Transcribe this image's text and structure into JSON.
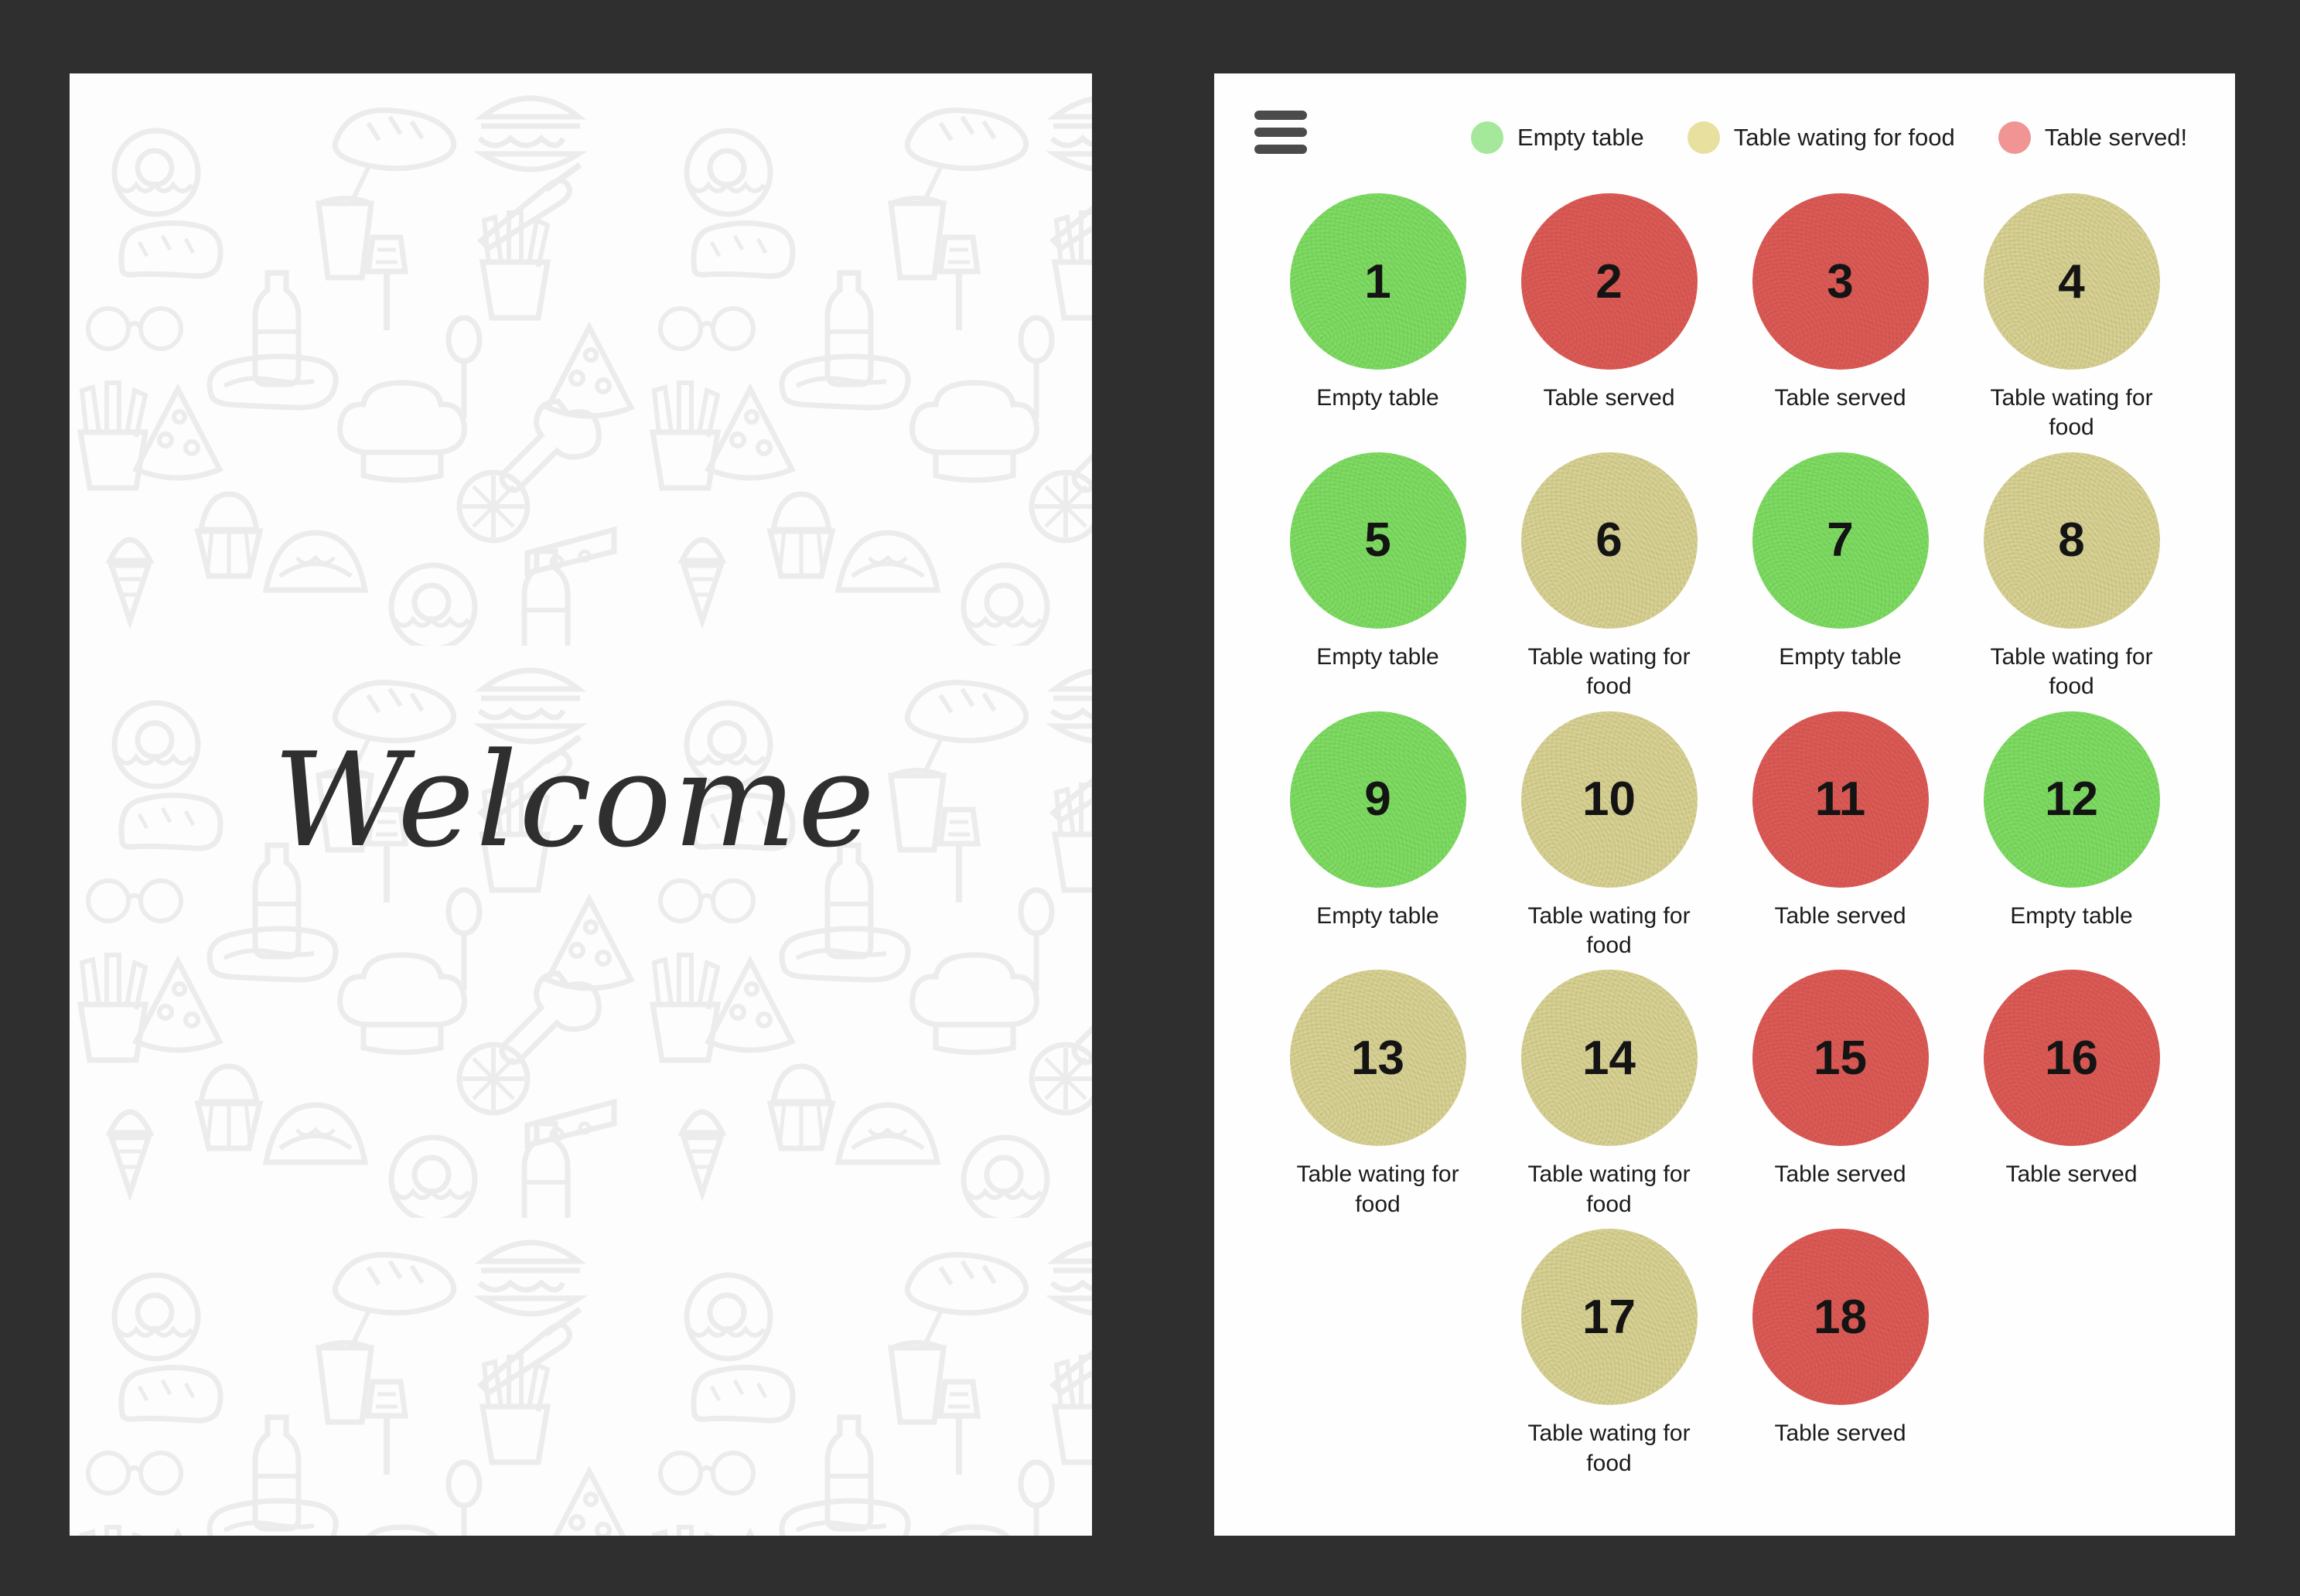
{
  "background_color": "#302f2f",
  "welcome_panel": {
    "title": "Welcome",
    "background_pattern": "food-doodle-pattern"
  },
  "tables_panel": {
    "menu_icon": "hamburger-menu-icon",
    "legend": [
      {
        "label": "Empty table",
        "color": "#A5E89B",
        "status_key": "empty"
      },
      {
        "label": "Table wating for food",
        "color": "#E8E09E",
        "status_key": "waiting"
      },
      {
        "label": "Table served!",
        "color": "#F09494",
        "status_key": "served"
      }
    ],
    "status_colors": {
      "empty": "#7EDD62",
      "waiting": "#D9D293",
      "served": "#DE5A55"
    },
    "tables": [
      {
        "number": "1",
        "status": "empty",
        "status_label": "Empty table"
      },
      {
        "number": "2",
        "status": "served",
        "status_label": "Table served"
      },
      {
        "number": "3",
        "status": "served",
        "status_label": "Table served"
      },
      {
        "number": "4",
        "status": "waiting",
        "status_label": "Table wating for food"
      },
      {
        "number": "5",
        "status": "empty",
        "status_label": "Empty table"
      },
      {
        "number": "6",
        "status": "waiting",
        "status_label": "Table wating for food"
      },
      {
        "number": "7",
        "status": "empty",
        "status_label": "Empty table"
      },
      {
        "number": "8",
        "status": "waiting",
        "status_label": "Table wating for food"
      },
      {
        "number": "9",
        "status": "empty",
        "status_label": "Empty table"
      },
      {
        "number": "10",
        "status": "waiting",
        "status_label": "Table wating for food"
      },
      {
        "number": "11",
        "status": "served",
        "status_label": "Table served"
      },
      {
        "number": "12",
        "status": "empty",
        "status_label": "Empty table"
      },
      {
        "number": "13",
        "status": "waiting",
        "status_label": "Table wating for food"
      },
      {
        "number": "14",
        "status": "waiting",
        "status_label": "Table wating for food"
      },
      {
        "number": "15",
        "status": "served",
        "status_label": "Table served"
      },
      {
        "number": "16",
        "status": "served",
        "status_label": "Table served"
      },
      {
        "number": "17",
        "status": "waiting",
        "status_label": "Table wating for food"
      },
      {
        "number": "18",
        "status": "served",
        "status_label": "Table served"
      }
    ]
  }
}
